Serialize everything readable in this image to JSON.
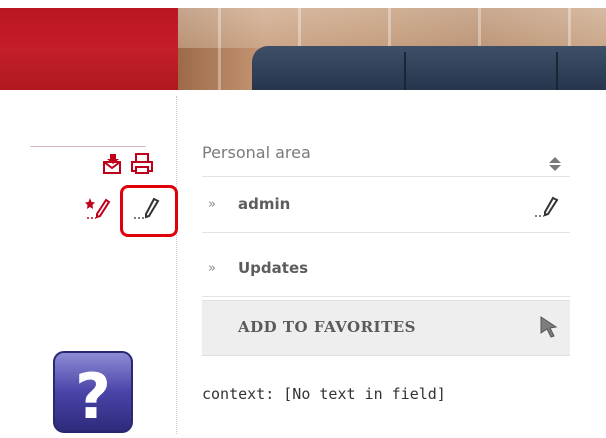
{
  "header": {
    "brand_color": "#c41e2a"
  },
  "sidebar": {
    "icons": [
      "mail-icon",
      "print-icon",
      "add-note-icon",
      "edit-icon",
      "help-icon"
    ],
    "highlight_color": "#e0000b"
  },
  "panel": {
    "select_label": "Personal area",
    "items": [
      {
        "label": "admin",
        "prefix": "»"
      },
      {
        "label": "Updates",
        "prefix": "»"
      }
    ],
    "favorites_label": "ADD TO FAVORITES"
  },
  "context_text": "context: [No text in field]"
}
